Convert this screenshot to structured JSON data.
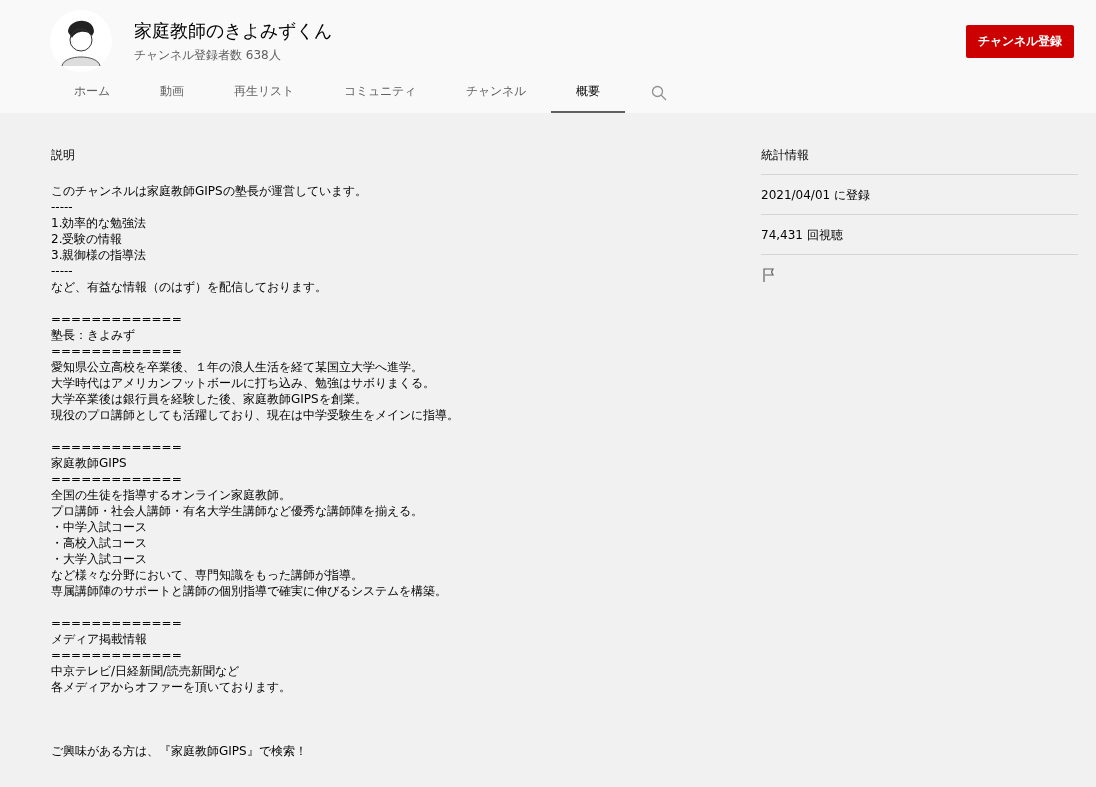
{
  "channel": {
    "name": "家庭教師のきよみずくん",
    "subscribers": "チャンネル登録者数 638人"
  },
  "subscribe_button": "チャンネル登録",
  "tabs": [
    {
      "label": "ホーム",
      "selected": false
    },
    {
      "label": "動画",
      "selected": false
    },
    {
      "label": "再生リスト",
      "selected": false
    },
    {
      "label": "コミュニティ",
      "selected": false
    },
    {
      "label": "チャンネル",
      "selected": false
    },
    {
      "label": "概要",
      "selected": true
    }
  ],
  "description": {
    "heading": "説明",
    "blocks": [
      [
        "このチャンネルは家庭教師GIPSの塾長が運営しています。",
        "-----",
        "1.効率的な勉強法",
        "2.受験の情報",
        "3.親御様の指導法",
        "-----",
        "など、有益な情報（のはず）を配信しております。"
      ],
      [
        "=============",
        "塾長：きよみず",
        "=============",
        "愛知県公立高校を卒業後、１年の浪人生活を経て某国立大学へ進学。",
        "大学時代はアメリカンフットボールに打ち込み、勉強はサボりまくる。",
        "大学卒業後は銀行員を経験した後、家庭教師GIPSを創業。",
        "現役のプロ講師としても活躍しており、現在は中学受験生をメインに指導。"
      ],
      [
        "=============",
        "家庭教師GIPS",
        "=============",
        "全国の生徒を指導するオンライン家庭教師。",
        "プロ講師・社会人講師・有名大学生講師など優秀な講師陣を揃える。",
        "・中学入試コース",
        "・高校入試コース",
        "・大学入試コース",
        "など様々な分野において、専門知識をもった講師が指導。",
        "専属講師陣のサポートと講師の個別指導で確実に伸びるシステムを構築。"
      ],
      [
        "=============",
        "メディア掲載情報",
        "=============",
        "中京テレビ/日経新聞/読売新聞など",
        "各メディアからオファーを頂いております。"
      ],
      [
        "ご興味がある方は、『家庭教師GIPS』で検索！"
      ]
    ]
  },
  "stats": {
    "heading": "統計情報",
    "items": [
      "2021/04/01 に登録",
      "74,431 回視聴"
    ]
  }
}
